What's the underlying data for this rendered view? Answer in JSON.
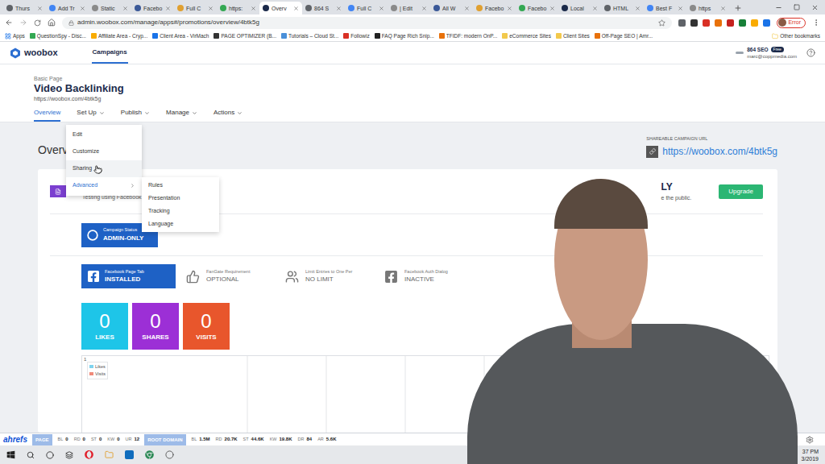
{
  "browser": {
    "tabs": [
      {
        "label": "Thurs",
        "selected": false
      },
      {
        "label": "Add Tr",
        "selected": false
      },
      {
        "label": "Static",
        "selected": false
      },
      {
        "label": "Facebo",
        "selected": false
      },
      {
        "label": "Full C",
        "selected": false
      },
      {
        "label": "https:",
        "selected": false
      },
      {
        "label": "Overv",
        "selected": true
      },
      {
        "label": "864 S",
        "selected": false
      },
      {
        "label": "Full C",
        "selected": false
      },
      {
        "label": "| Edit",
        "selected": false
      },
      {
        "label": "All W",
        "selected": false
      },
      {
        "label": "Facebo",
        "selected": false
      },
      {
        "label": "Facebo",
        "selected": false
      },
      {
        "label": "Local",
        "selected": false
      },
      {
        "label": "HTML",
        "selected": false
      },
      {
        "label": "Best F",
        "selected": false
      },
      {
        "label": "https",
        "selected": false
      }
    ],
    "url": "admin.woobox.com/manage/apps#/promotions/overview/4btk5g",
    "profile_badge": "Error",
    "bookmarks": [
      "Apps",
      "QuestionSpy - Disc...",
      "Affiliate Area - Cryp...",
      "Client Area - VirMach",
      "PAGE OPTIMIZER (B...",
      "Tutorials – Cloud St...",
      "Followiz",
      "FAQ Page Rich Snip...",
      "TFIDF: modern OnP...",
      "eCommerce Sites",
      "Client Sites",
      "Off-Page SEO | Amr..."
    ],
    "other_bookmarks": "Other bookmarks"
  },
  "app": {
    "logo": "woobox",
    "nav": [
      {
        "label": "Campaigns",
        "selected": true
      }
    ],
    "account": {
      "name": "864 SEO",
      "plan": "Free",
      "email": "marc@coppmedia.com"
    }
  },
  "page": {
    "type": "Basic Page",
    "title": "Video Backlinking",
    "url": "https://woobox.com/4btk5g",
    "tabs": [
      {
        "label": "Overview",
        "selected": true,
        "dropdown": false,
        "expanded": false
      },
      {
        "label": "Set Up",
        "selected": false,
        "dropdown": true,
        "expanded": true
      },
      {
        "label": "Publish",
        "selected": false,
        "dropdown": true,
        "expanded": false
      },
      {
        "label": "Manage",
        "selected": false,
        "dropdown": true,
        "expanded": false
      },
      {
        "label": "Actions",
        "selected": false,
        "dropdown": true,
        "expanded": false
      }
    ]
  },
  "setup_menu": {
    "items": [
      {
        "label": "Edit",
        "hovered": false,
        "submenu": false,
        "expanded": false
      },
      {
        "label": "Customize",
        "hovered": false,
        "submenu": false,
        "expanded": false
      },
      {
        "label": "Sharing",
        "hovered": true,
        "submenu": false,
        "expanded": false
      },
      {
        "label": "Advanced",
        "hovered": false,
        "submenu": true,
        "expanded": true
      }
    ],
    "submenu": [
      "Rules",
      "Presentation",
      "Tracking",
      "Language"
    ]
  },
  "heading": "Overv",
  "share": {
    "label": "SHAREABLE CAMPAIGN URL",
    "url": "https://woobox.com/4btk5g"
  },
  "card": {
    "title": "Video Backlinking",
    "subtitle": "Testing using Facebook",
    "status_title": "LY",
    "status_text": "e the public.",
    "upgrade": "Upgrade"
  },
  "campaign_status": {
    "label": "Campaign Status",
    "value": "ADMIN-ONLY"
  },
  "settings": [
    {
      "label": "Facebook Page Tab",
      "value": "INSTALLED",
      "kind": "box"
    },
    {
      "label": "FanGate Requirement",
      "value": "OPTIONAL",
      "kind": "plain"
    },
    {
      "label": "Limit Entries to One Per",
      "value": "NO LIMIT",
      "kind": "plain"
    },
    {
      "label": "Facebook Auth Dialog",
      "value": "INACTIVE",
      "kind": "plain"
    }
  ],
  "stats": [
    {
      "value": "0",
      "label": "LIKES",
      "color": "#1ec5e8"
    },
    {
      "value": "0",
      "label": "SHARES",
      "color": "#9c2fd6"
    },
    {
      "value": "0",
      "label": "VISITS",
      "color": "#e8562c"
    }
  ],
  "chart": {
    "y_ticks": [
      "1"
    ],
    "series": [
      {
        "name": "Likes",
        "color": "#7fd3ee",
        "values": [
          0,
          0,
          0,
          0,
          0,
          0,
          0,
          0
        ]
      },
      {
        "name": "Visits",
        "color": "#f08a7a",
        "values": [
          0,
          0,
          0,
          0,
          0,
          0,
          0,
          0
        ]
      }
    ]
  },
  "ahrefs": {
    "logo": "ahrefs",
    "groups": [
      {
        "label": "PAGE",
        "metrics": [
          {
            "name": "BL",
            "value": "0"
          },
          {
            "name": "RD",
            "value": "0"
          },
          {
            "name": "ST",
            "value": "0"
          },
          {
            "name": "KW",
            "value": "0"
          },
          {
            "name": "UR",
            "value": "12"
          }
        ]
      },
      {
        "label": "ROOT DOMAIN",
        "metrics": [
          {
            "name": "BL",
            "value": "1.5M"
          },
          {
            "name": "RD",
            "value": "20.7K"
          },
          {
            "name": "ST",
            "value": "44.6K"
          },
          {
            "name": "KW",
            "value": "19.8K"
          },
          {
            "name": "DR",
            "value": "84"
          },
          {
            "name": "AR",
            "value": "5.6K"
          }
        ]
      }
    ]
  },
  "taskbar": {
    "time": "37 PM",
    "date": "3/2019"
  }
}
